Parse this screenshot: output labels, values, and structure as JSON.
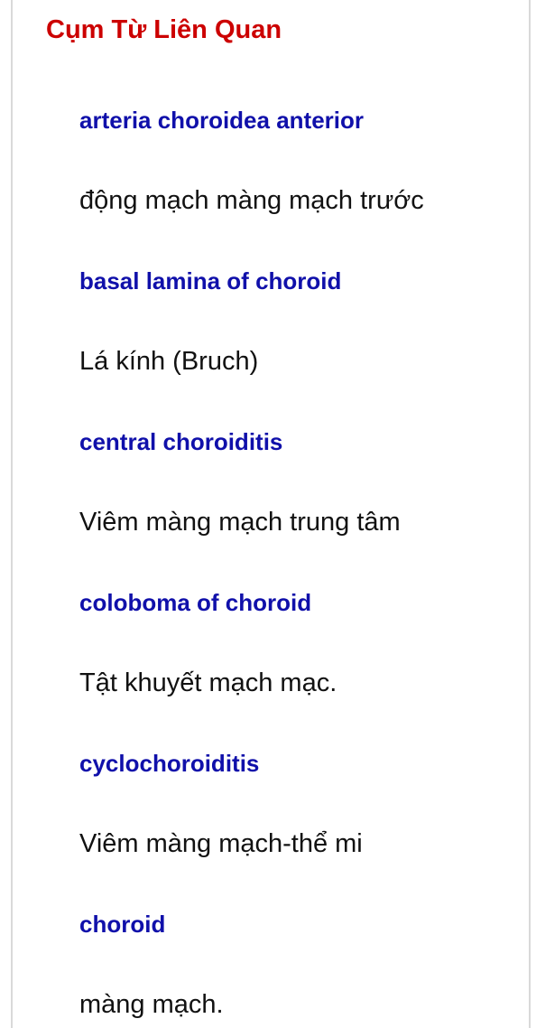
{
  "section": {
    "title": "Cụm Từ Liên Quan"
  },
  "phrases": [
    {
      "term": "arteria choroidea anterior",
      "meaning": "động mạch màng mạch trước"
    },
    {
      "term": "basal lamina of choroid",
      "meaning": "Lá kính (Bruch)"
    },
    {
      "term": "central choroiditis",
      "meaning": "Viêm màng mạch trung tâm"
    },
    {
      "term": "coloboma of choroid",
      "meaning": "Tật khuyết mạch mạc."
    },
    {
      "term": "cyclochoroiditis",
      "meaning": "Viêm màng mạch-thể mi"
    },
    {
      "term": "choroid",
      "meaning": "màng mạch."
    }
  ],
  "colors": {
    "title": "#cc0000",
    "term_link": "#1010aa",
    "meaning_text": "#111111",
    "frame_border": "#d9d9d9"
  }
}
